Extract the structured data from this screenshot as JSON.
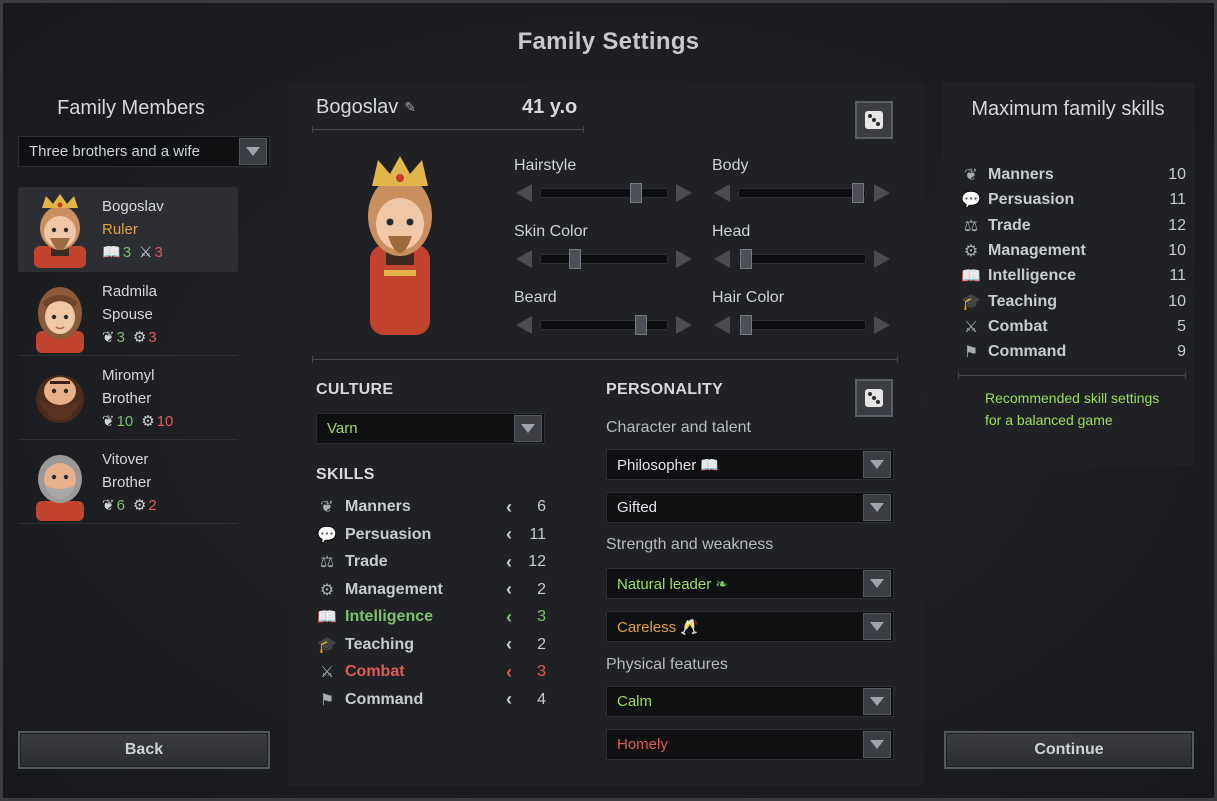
{
  "title": "Family Settings",
  "left": {
    "heading": "Family Members",
    "preset": "Three brothers and a wife",
    "members": [
      {
        "name": "Bogoslav",
        "role": "Ruler",
        "stat1": "3",
        "stat2": "3"
      },
      {
        "name": "Radmila",
        "role": "Spouse",
        "stat1": "3",
        "stat2": "3"
      },
      {
        "name": "Miromyl",
        "role": "Brother",
        "stat1": "10",
        "stat2": "10"
      },
      {
        "name": "Vitover",
        "role": "Brother",
        "stat1": "6",
        "stat2": "2"
      }
    ],
    "back_label": "Back"
  },
  "character": {
    "name": "Bogoslav",
    "age": "41 y.o",
    "sliders": [
      {
        "label": "Hairstyle",
        "level": 0.78
      },
      {
        "label": "Body",
        "level": 0.98
      },
      {
        "label": "Skin Color",
        "level": 0.25
      },
      {
        "label": "Head",
        "level": 0.02
      },
      {
        "label": "Beard",
        "level": 0.82
      },
      {
        "label": "Hair Color",
        "level": 0.02
      }
    ]
  },
  "culture": {
    "heading": "CULTURE",
    "value": "Varn"
  },
  "skills": {
    "heading": "SKILLS",
    "items": [
      {
        "name": "Manners",
        "value": "6",
        "icon": "manners-icon",
        "color": "#c8cbd0"
      },
      {
        "name": "Persuasion",
        "value": "11",
        "icon": "persuasion-icon",
        "color": "#c8cbd0"
      },
      {
        "name": "Trade",
        "value": "12",
        "icon": "trade-icon",
        "color": "#c8cbd0"
      },
      {
        "name": "Management",
        "value": "2",
        "icon": "management-icon",
        "color": "#c8cbd0"
      },
      {
        "name": "Intelligence",
        "value": "3",
        "icon": "intelligence-icon",
        "color": "#7cc36b"
      },
      {
        "name": "Teaching",
        "value": "2",
        "icon": "teaching-icon",
        "color": "#c8cbd0"
      },
      {
        "name": "Combat",
        "value": "3",
        "icon": "combat-icon",
        "color": "#e05b57"
      },
      {
        "name": "Command",
        "value": "4",
        "icon": "command-icon",
        "color": "#c8cbd0"
      }
    ]
  },
  "personality": {
    "heading": "PERSONALITY",
    "character_heading": "Character and talent",
    "character": "Philosopher",
    "talent": "Gifted",
    "strength_heading": "Strength and weakness",
    "strength": "Natural leader",
    "weakness": "Careless",
    "physical_heading": "Physical features",
    "physical1": "Calm",
    "physical2": "Homely"
  },
  "max_skills": {
    "heading": "Maximum family skills",
    "items": [
      {
        "name": "Manners",
        "value": "10",
        "icon": "manners-icon"
      },
      {
        "name": "Persuasion",
        "value": "11",
        "icon": "persuasion-icon"
      },
      {
        "name": "Trade",
        "value": "12",
        "icon": "trade-icon"
      },
      {
        "name": "Management",
        "value": "10",
        "icon": "management-icon"
      },
      {
        "name": "Intelligence",
        "value": "11",
        "icon": "intelligence-icon"
      },
      {
        "name": "Teaching",
        "value": "10",
        "icon": "teaching-icon"
      },
      {
        "name": "Combat",
        "value": "5",
        "icon": "combat-icon"
      },
      {
        "name": "Command",
        "value": "9",
        "icon": "command-icon"
      }
    ],
    "note": "Recommended skill settings for a balanced game"
  },
  "continue_label": "Continue"
}
